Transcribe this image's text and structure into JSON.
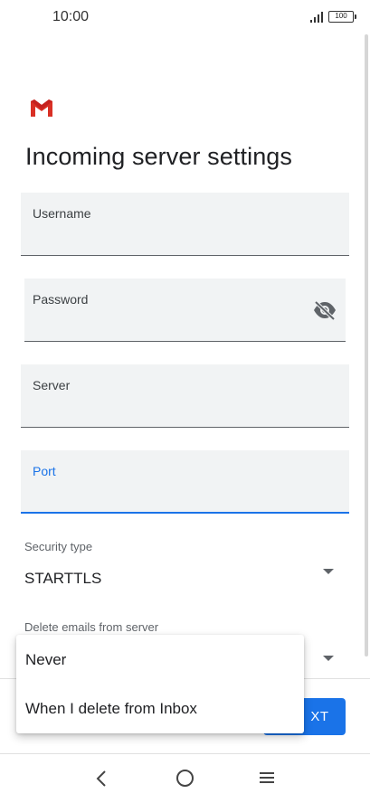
{
  "status_bar": {
    "time": "10:00",
    "battery": "100"
  },
  "page": {
    "title": "Incoming server settings"
  },
  "fields": {
    "username": {
      "label": "Username",
      "value": ""
    },
    "password": {
      "label": "Password",
      "value": ""
    },
    "server": {
      "label": "Server",
      "value": ""
    },
    "port": {
      "label": "Port",
      "value": ""
    }
  },
  "security": {
    "label": "Security type",
    "value": "STARTTLS"
  },
  "delete_emails": {
    "label": "Delete emails from server"
  },
  "menu": {
    "items": [
      "Never",
      "When I delete from Inbox"
    ]
  },
  "actions": {
    "next_label": "NEXT",
    "next_visible_text": "XT"
  },
  "colors": {
    "accent": "#1a73e8",
    "field_bg": "#f1f3f4",
    "gmail_red": "#d93025"
  },
  "icons": [
    "signal-icon",
    "battery-icon",
    "gmail-logo",
    "eye-off-icon",
    "dropdown-arrow-icon",
    "back-icon",
    "home-icon",
    "recents-icon"
  ]
}
